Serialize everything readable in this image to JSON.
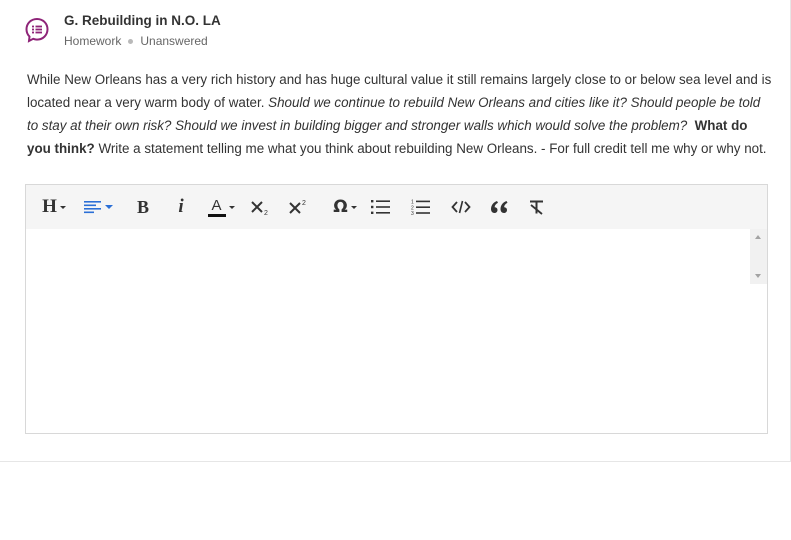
{
  "question": {
    "title": "G. Rebuilding in N.O. LA",
    "category": "Homework",
    "status": "Unanswered",
    "icon": "question-list-icon",
    "accent_color": "#8e2478"
  },
  "prompt": {
    "part1": "While New Orleans has a very rich history and has huge cultural value it still remains largely close to or below sea level and is located near a very warm body of water. ",
    "part2_italic": "Should we continue to rebuild New Orleans and cities like it? Should people be told to stay at their own risk? Should we invest in building bigger and stronger walls which would solve the problem?",
    "part3_bold": "What do you think?",
    "part4": "Write a statement telling me what you think about rebuilding New Orleans. - For full credit tell me why or why not."
  },
  "toolbar": {
    "heading": "H",
    "bold": "B",
    "italic": "i",
    "font_color": "A",
    "special_chars": "Ω",
    "icons": [
      "heading-icon",
      "align-icon",
      "bold-icon",
      "italic-icon",
      "font-color-icon",
      "subscript-icon",
      "superscript-icon",
      "special-characters-icon",
      "bulleted-list-icon",
      "numbered-list-icon",
      "code-icon",
      "blockquote-icon",
      "clear-formatting-icon"
    ]
  },
  "editor": {
    "value": ""
  }
}
